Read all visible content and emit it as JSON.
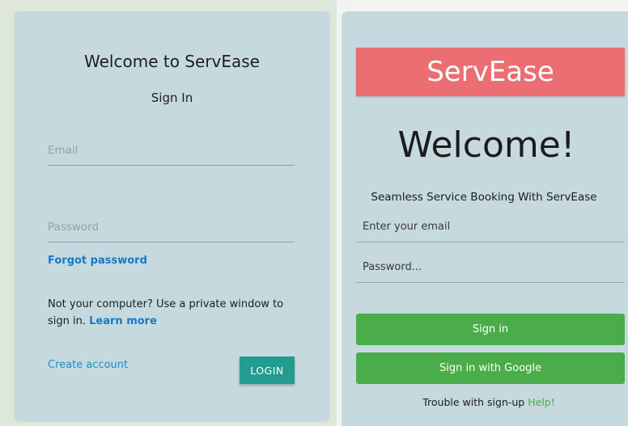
{
  "left_panel": {
    "title": "Welcome to ServEase",
    "subtitle": "Sign In",
    "email_placeholder": "Email",
    "password_placeholder": "Password",
    "forgot_password": "Forgot password",
    "private_note": "Not your computer? Use a private window to sign in.",
    "learn_more": "Learn more",
    "create_account": "Create account",
    "login_button": "LOGIN"
  },
  "right_panel": {
    "brand": "ServEase",
    "welcome": "Welcome!",
    "tagline": "Seamless Service Booking With ServEase",
    "email_placeholder": "Enter your email",
    "password_placeholder": "Password...",
    "signin_button": "Sign in",
    "google_button": "Sign in with Google",
    "trouble_text": "Trouble with sign-up",
    "help_link": "Help!"
  },
  "colors": {
    "card_bg": "#c5d9de",
    "brand_banner": "#eb6f72",
    "login_button": "#239b8f",
    "green_button": "#4bac4a",
    "link_blue": "#1979c6"
  }
}
